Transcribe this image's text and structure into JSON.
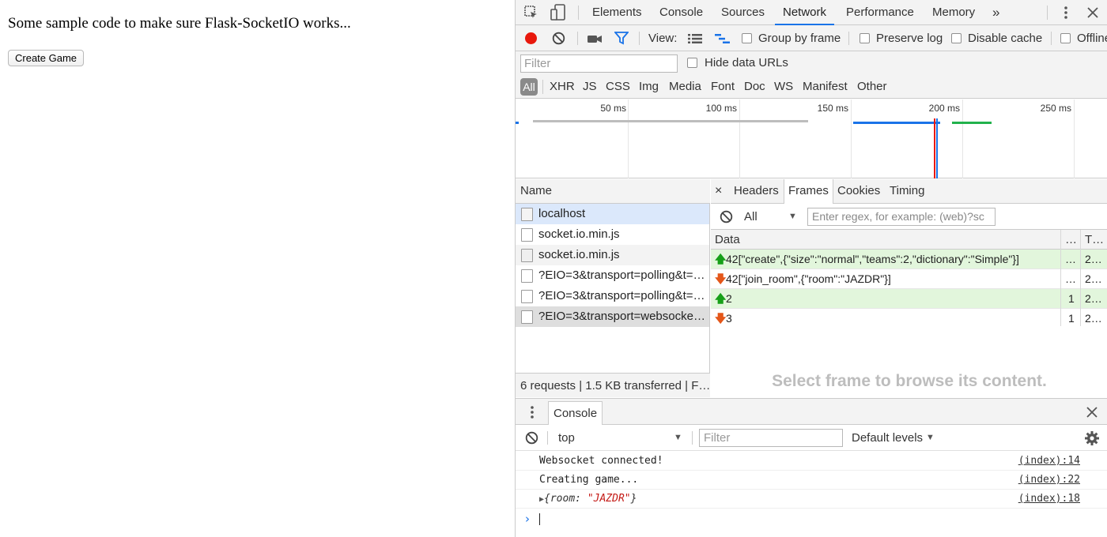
{
  "page": {
    "heading": "Some sample code to make sure Flask-SocketIO works...",
    "button_label": "Create Game"
  },
  "devtools": {
    "main_tabs": [
      "Elements",
      "Console",
      "Sources",
      "Network",
      "Performance",
      "Memory"
    ],
    "active_tab": "Network",
    "more_tabs_glyph": "»",
    "toolbar": {
      "view_label": "View:",
      "group_by_frame": "Group by frame",
      "preserve_log": "Preserve log",
      "disable_cache": "Disable cache",
      "offline": "Offline"
    },
    "filter": {
      "placeholder": "Filter",
      "hide_data_urls": "Hide data URLs"
    },
    "type_filters": [
      "All",
      "XHR",
      "JS",
      "CSS",
      "Img",
      "Media",
      "Font",
      "Doc",
      "WS",
      "Manifest",
      "Other"
    ],
    "timeline_labels": [
      "50 ms",
      "100 ms",
      "150 ms",
      "200 ms",
      "250 ms"
    ],
    "requests": {
      "header": "Name",
      "rows": [
        "localhost",
        "socket.io.min.js",
        "socket.io.min.js",
        "?EIO=3&transport=polling&t=…",
        "?EIO=3&transport=polling&t=…",
        "?EIO=3&transport=websocke…"
      ],
      "status": "6 requests | 1.5 KB transferred | F…"
    },
    "detail": {
      "close_glyph": "×",
      "tabs": [
        "Headers",
        "Frames",
        "Cookies",
        "Timing"
      ],
      "active_tab": "Frames",
      "frames_filter_value": "All",
      "regex_placeholder": "Enter regex, for example: (web)?sc",
      "columns": [
        "Data",
        "…",
        "T…"
      ],
      "frames": [
        {
          "direction": "sent",
          "data": "42[\"create\",{\"size\":\"normal\",\"teams\":2,\"dictionary\":\"Simple\"}]",
          "length": "…",
          "time": "2…"
        },
        {
          "direction": "received",
          "data": "42[\"join_room\",{\"room\":\"JAZDR\"}]",
          "length": "…",
          "time": "2…"
        },
        {
          "direction": "sent",
          "data": "2",
          "length": "1",
          "time": "2…"
        },
        {
          "direction": "received",
          "data": "3",
          "length": "1",
          "time": "2…"
        }
      ],
      "placeholder": "Select frame to browse its content."
    },
    "console": {
      "tab_label": "Console",
      "context": "top",
      "filter_placeholder": "Filter",
      "levels": "Default levels",
      "logs": [
        {
          "message": "Websocket connected!",
          "source": "(index):14"
        },
        {
          "message": "Creating game...",
          "source": "(index):22"
        },
        {
          "key": "room",
          "value": "\"JAZDR\"",
          "source": "(index):18"
        }
      ],
      "prompt": "›"
    }
  }
}
